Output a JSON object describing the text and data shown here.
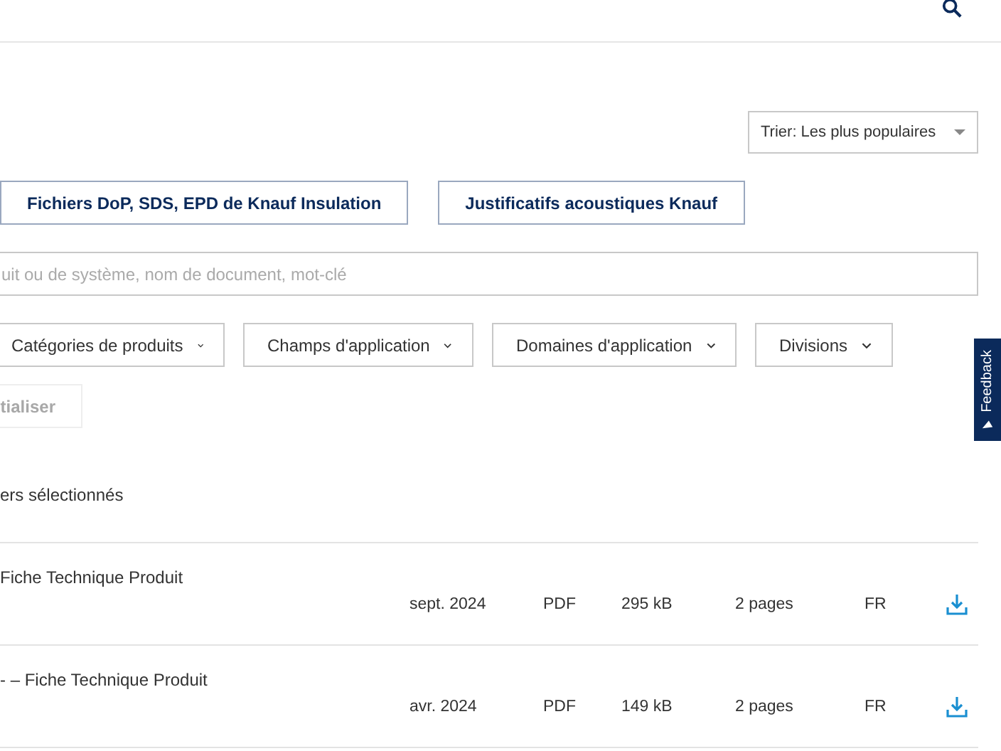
{
  "sort": {
    "label": "Trier: Les plus populaires"
  },
  "quick_links": [
    {
      "label": "Fichiers DoP, SDS, EPD de Knauf Insulation"
    },
    {
      "label": "Justificatifs acoustiques Knauf"
    }
  ],
  "search": {
    "placeholder": "uit ou de système, nom de document, mot-clé"
  },
  "filters": [
    {
      "label": "Catégories de produits"
    },
    {
      "label": "Champs d'application"
    },
    {
      "label": "Domaines d'application"
    },
    {
      "label": "Divisions"
    }
  ],
  "reset": {
    "label": "tialiser",
    "disabled": true
  },
  "selection_text": "ers sélectionnés",
  "documents": [
    {
      "title": "Fiche Technique Produit",
      "date": "sept. 2024",
      "format": "PDF",
      "size": "295 kB",
      "pages": "2 pages",
      "language": "FR"
    },
    {
      "title": "- – Fiche Technique Produit",
      "date": "avr. 2024",
      "format": "PDF",
      "size": "149 kB",
      "pages": "2 pages",
      "language": "FR"
    }
  ],
  "feedback": {
    "label": "Feedback"
  }
}
